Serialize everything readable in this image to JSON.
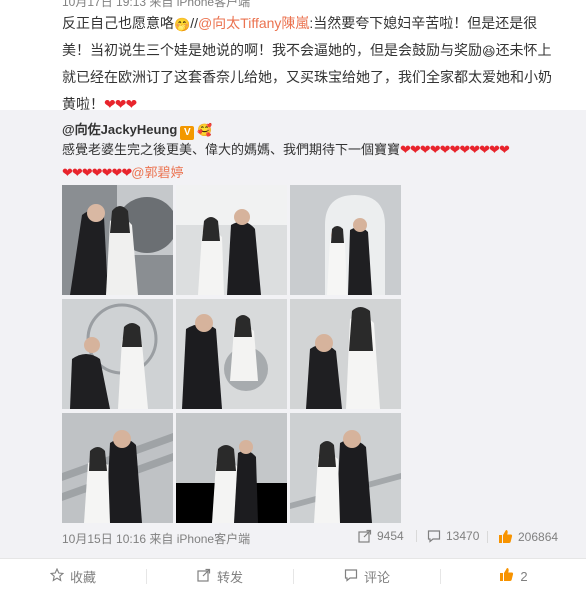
{
  "post": {
    "meta": "10月17日 19:13 来自 iPhone客户端",
    "line1_a": "反正自己也愿意咯",
    "line1_sep": "//",
    "line1_mention": "@向太Tiffany陳嵐",
    "line1_b": ":当然要夸下媳妇辛苦啦！但是还是很",
    "line2_a": "美！当初说生三个娃是她说的啊！我不会逼她的，但是会鼓励与奖励",
    "line2_b": "还未怀上",
    "line3": "就已经在欧洲订了这套香奈儿给她，又买珠宝给她了，我们全家都太爱她和小奶",
    "line4": "黄啦！",
    "hearts": "❤❤❤"
  },
  "repost": {
    "author": "@向佐JackyHeung",
    "verified_badge": "V",
    "text_a": "感覺老婆生完之後更美、偉大的媽媽、我們期待下一個寶寶",
    "hearts_a": "❤❤❤❤❤❤❤❤❤❤❤",
    "hearts_b": "❤❤❤❤❤❤❤",
    "mention": "@郭碧婷",
    "time": "10月15日 10:16 来自 iPhone客户端",
    "reposts": "9454",
    "comments": "13470",
    "likes": "206864"
  },
  "actions": {
    "favorite": "收藏",
    "forward": "转发",
    "comment": "评论",
    "like_count": "2"
  },
  "icons": {
    "favorite": "star-icon",
    "forward": "share-icon",
    "comment": "comment-icon",
    "like": "thumbs-up-icon"
  },
  "colors": {
    "link": "#eb7350",
    "heart": "#e8242c",
    "repost_bg": "#f2f2f5",
    "like_orange": "#f79300"
  }
}
